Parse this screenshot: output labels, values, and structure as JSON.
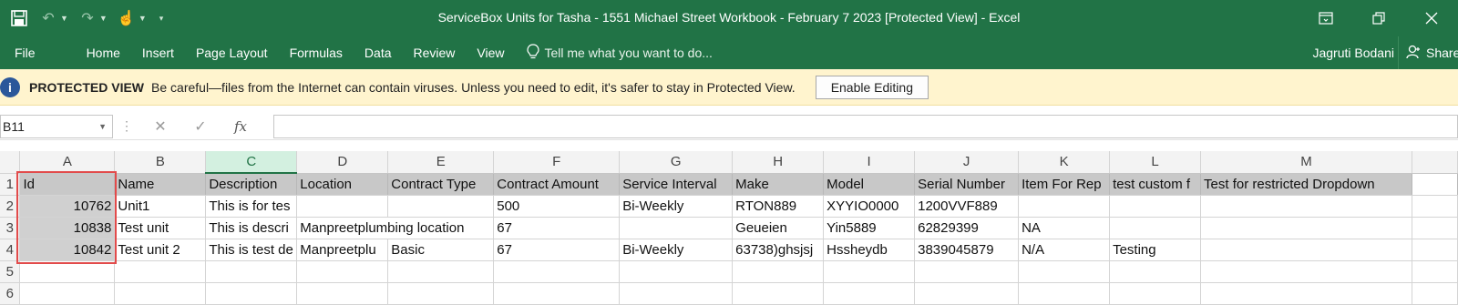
{
  "titlebar": {
    "title": "ServiceBox Units for Tasha - 1551 Michael Street Workbook - February 7 2023  [Protected View] - Excel",
    "buttons": [
      "restore-ribbon",
      "restore",
      "close"
    ]
  },
  "ribbon": {
    "tabs": [
      "File",
      "Home",
      "Insert",
      "Page Layout",
      "Formulas",
      "Data",
      "Review",
      "View"
    ],
    "tell_me": "Tell me what you want to do...",
    "user": "Jagruti Bodani",
    "share": "Share"
  },
  "protected_view": {
    "title": "PROTECTED VIEW",
    "message": "Be careful—files from the Internet can contain viruses. Unless you need to edit, it's safer to stay in Protected View.",
    "button": "Enable Editing"
  },
  "formula_bar": {
    "name_box": "B11",
    "formula": ""
  },
  "sheet": {
    "columns": [
      "A",
      "B",
      "C",
      "D",
      "E",
      "F",
      "G",
      "H",
      "I",
      "J",
      "K",
      "L",
      "M"
    ],
    "selected_column": "C",
    "rows": [
      "1",
      "2",
      "3",
      "4",
      "5",
      "6"
    ],
    "header_row": [
      "Id",
      "Name",
      "Description",
      "Location",
      "Contract Type",
      "Contract Amount",
      "Service Interval",
      "Make",
      "Model",
      "Serial Number",
      "Item For Rep",
      "test custom f",
      "Test for restricted Dropdown"
    ],
    "data_rows": [
      [
        "10762",
        "Unit1",
        "This is for tes",
        "",
        "",
        "500",
        "Bi-Weekly",
        "RTON889",
        "XYYIO0000",
        "1200VVF889",
        "",
        "",
        ""
      ],
      [
        "10838",
        "Test unit",
        "This is descri",
        "Manpreetplumbing location",
        "",
        "67",
        "",
        "Geueien",
        "Yin5889",
        "62829399",
        "NA",
        "",
        ""
      ],
      [
        "10842",
        "Test unit 2",
        "This is test de",
        "Manpreetplu",
        "Basic",
        "67",
        "Bi-Weekly",
        "63738)ghsjsj",
        "Hssheydb",
        "3839045879",
        "N/A",
        "Testing",
        ""
      ]
    ]
  },
  "colors": {
    "ribbon": "#217346",
    "highlight_box": "#e24b4b",
    "protected_bar": "#fff4ce"
  }
}
